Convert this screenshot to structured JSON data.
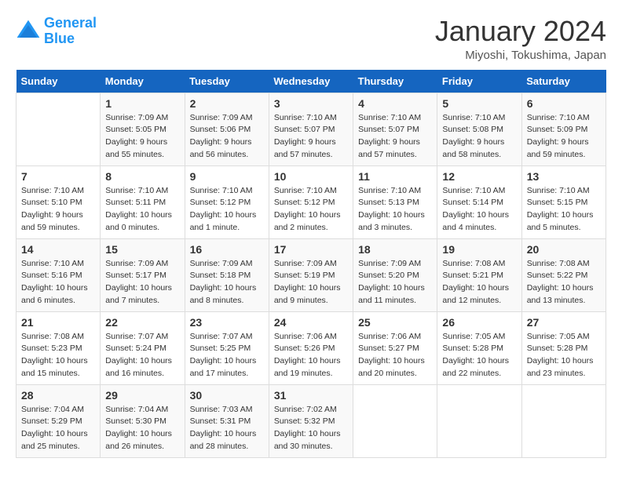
{
  "logo": {
    "line1": "General",
    "line2": "Blue"
  },
  "title": "January 2024",
  "location": "Miyoshi, Tokushima, Japan",
  "days_header": [
    "Sunday",
    "Monday",
    "Tuesday",
    "Wednesday",
    "Thursday",
    "Friday",
    "Saturday"
  ],
  "weeks": [
    [
      {
        "day": "",
        "sunrise": "",
        "sunset": "",
        "daylight": ""
      },
      {
        "day": "1",
        "sunrise": "Sunrise: 7:09 AM",
        "sunset": "Sunset: 5:05 PM",
        "daylight": "Daylight: 9 hours and 55 minutes."
      },
      {
        "day": "2",
        "sunrise": "Sunrise: 7:09 AM",
        "sunset": "Sunset: 5:06 PM",
        "daylight": "Daylight: 9 hours and 56 minutes."
      },
      {
        "day": "3",
        "sunrise": "Sunrise: 7:10 AM",
        "sunset": "Sunset: 5:07 PM",
        "daylight": "Daylight: 9 hours and 57 minutes."
      },
      {
        "day": "4",
        "sunrise": "Sunrise: 7:10 AM",
        "sunset": "Sunset: 5:07 PM",
        "daylight": "Daylight: 9 hours and 57 minutes."
      },
      {
        "day": "5",
        "sunrise": "Sunrise: 7:10 AM",
        "sunset": "Sunset: 5:08 PM",
        "daylight": "Daylight: 9 hours and 58 minutes."
      },
      {
        "day": "6",
        "sunrise": "Sunrise: 7:10 AM",
        "sunset": "Sunset: 5:09 PM",
        "daylight": "Daylight: 9 hours and 59 minutes."
      }
    ],
    [
      {
        "day": "7",
        "sunrise": "Sunrise: 7:10 AM",
        "sunset": "Sunset: 5:10 PM",
        "daylight": "Daylight: 9 hours and 59 minutes."
      },
      {
        "day": "8",
        "sunrise": "Sunrise: 7:10 AM",
        "sunset": "Sunset: 5:11 PM",
        "daylight": "Daylight: 10 hours and 0 minutes."
      },
      {
        "day": "9",
        "sunrise": "Sunrise: 7:10 AM",
        "sunset": "Sunset: 5:12 PM",
        "daylight": "Daylight: 10 hours and 1 minute."
      },
      {
        "day": "10",
        "sunrise": "Sunrise: 7:10 AM",
        "sunset": "Sunset: 5:12 PM",
        "daylight": "Daylight: 10 hours and 2 minutes."
      },
      {
        "day": "11",
        "sunrise": "Sunrise: 7:10 AM",
        "sunset": "Sunset: 5:13 PM",
        "daylight": "Daylight: 10 hours and 3 minutes."
      },
      {
        "day": "12",
        "sunrise": "Sunrise: 7:10 AM",
        "sunset": "Sunset: 5:14 PM",
        "daylight": "Daylight: 10 hours and 4 minutes."
      },
      {
        "day": "13",
        "sunrise": "Sunrise: 7:10 AM",
        "sunset": "Sunset: 5:15 PM",
        "daylight": "Daylight: 10 hours and 5 minutes."
      }
    ],
    [
      {
        "day": "14",
        "sunrise": "Sunrise: 7:10 AM",
        "sunset": "Sunset: 5:16 PM",
        "daylight": "Daylight: 10 hours and 6 minutes."
      },
      {
        "day": "15",
        "sunrise": "Sunrise: 7:09 AM",
        "sunset": "Sunset: 5:17 PM",
        "daylight": "Daylight: 10 hours and 7 minutes."
      },
      {
        "day": "16",
        "sunrise": "Sunrise: 7:09 AM",
        "sunset": "Sunset: 5:18 PM",
        "daylight": "Daylight: 10 hours and 8 minutes."
      },
      {
        "day": "17",
        "sunrise": "Sunrise: 7:09 AM",
        "sunset": "Sunset: 5:19 PM",
        "daylight": "Daylight: 10 hours and 9 minutes."
      },
      {
        "day": "18",
        "sunrise": "Sunrise: 7:09 AM",
        "sunset": "Sunset: 5:20 PM",
        "daylight": "Daylight: 10 hours and 11 minutes."
      },
      {
        "day": "19",
        "sunrise": "Sunrise: 7:08 AM",
        "sunset": "Sunset: 5:21 PM",
        "daylight": "Daylight: 10 hours and 12 minutes."
      },
      {
        "day": "20",
        "sunrise": "Sunrise: 7:08 AM",
        "sunset": "Sunset: 5:22 PM",
        "daylight": "Daylight: 10 hours and 13 minutes."
      }
    ],
    [
      {
        "day": "21",
        "sunrise": "Sunrise: 7:08 AM",
        "sunset": "Sunset: 5:23 PM",
        "daylight": "Daylight: 10 hours and 15 minutes."
      },
      {
        "day": "22",
        "sunrise": "Sunrise: 7:07 AM",
        "sunset": "Sunset: 5:24 PM",
        "daylight": "Daylight: 10 hours and 16 minutes."
      },
      {
        "day": "23",
        "sunrise": "Sunrise: 7:07 AM",
        "sunset": "Sunset: 5:25 PM",
        "daylight": "Daylight: 10 hours and 17 minutes."
      },
      {
        "day": "24",
        "sunrise": "Sunrise: 7:06 AM",
        "sunset": "Sunset: 5:26 PM",
        "daylight": "Daylight: 10 hours and 19 minutes."
      },
      {
        "day": "25",
        "sunrise": "Sunrise: 7:06 AM",
        "sunset": "Sunset: 5:27 PM",
        "daylight": "Daylight: 10 hours and 20 minutes."
      },
      {
        "day": "26",
        "sunrise": "Sunrise: 7:05 AM",
        "sunset": "Sunset: 5:28 PM",
        "daylight": "Daylight: 10 hours and 22 minutes."
      },
      {
        "day": "27",
        "sunrise": "Sunrise: 7:05 AM",
        "sunset": "Sunset: 5:28 PM",
        "daylight": "Daylight: 10 hours and 23 minutes."
      }
    ],
    [
      {
        "day": "28",
        "sunrise": "Sunrise: 7:04 AM",
        "sunset": "Sunset: 5:29 PM",
        "daylight": "Daylight: 10 hours and 25 minutes."
      },
      {
        "day": "29",
        "sunrise": "Sunrise: 7:04 AM",
        "sunset": "Sunset: 5:30 PM",
        "daylight": "Daylight: 10 hours and 26 minutes."
      },
      {
        "day": "30",
        "sunrise": "Sunrise: 7:03 AM",
        "sunset": "Sunset: 5:31 PM",
        "daylight": "Daylight: 10 hours and 28 minutes."
      },
      {
        "day": "31",
        "sunrise": "Sunrise: 7:02 AM",
        "sunset": "Sunset: 5:32 PM",
        "daylight": "Daylight: 10 hours and 30 minutes."
      },
      {
        "day": "",
        "sunrise": "",
        "sunset": "",
        "daylight": ""
      },
      {
        "day": "",
        "sunrise": "",
        "sunset": "",
        "daylight": ""
      },
      {
        "day": "",
        "sunrise": "",
        "sunset": "",
        "daylight": ""
      }
    ]
  ]
}
